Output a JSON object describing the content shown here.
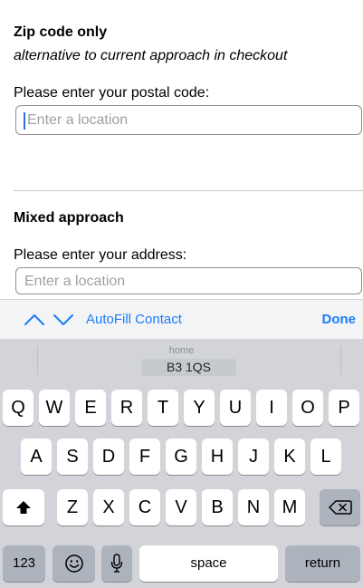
{
  "zip_section": {
    "title": "Zip code only",
    "subtitle": "alternative to current approach in checkout",
    "label": "Please enter your postal code:",
    "placeholder": "Enter a location"
  },
  "mixed_section": {
    "title": "Mixed approach",
    "label": "Please enter your address:",
    "placeholder": "Enter a location"
  },
  "toolbar": {
    "up_icon": "chevron-up-icon",
    "down_icon": "chevron-down-icon",
    "autofill_label": "AutoFill Contact",
    "done_label": "Done",
    "accent_color": "#1b7cf5"
  },
  "keyboard": {
    "suggestion": {
      "label": "home",
      "value": "B3 1QS"
    },
    "row1": [
      "Q",
      "W",
      "E",
      "R",
      "T",
      "Y",
      "U",
      "I",
      "O",
      "P"
    ],
    "row2": [
      "A",
      "S",
      "D",
      "F",
      "G",
      "H",
      "J",
      "K",
      "L"
    ],
    "row3": [
      "Z",
      "X",
      "C",
      "V",
      "B",
      "N",
      "M"
    ],
    "shift_icon": "shift-arrow-icon",
    "backspace_icon": "backspace-icon",
    "numbers_label": "123",
    "emoji_icon": "emoji-icon",
    "mic_icon": "microphone-icon",
    "space_label": "space",
    "return_label": "return"
  }
}
